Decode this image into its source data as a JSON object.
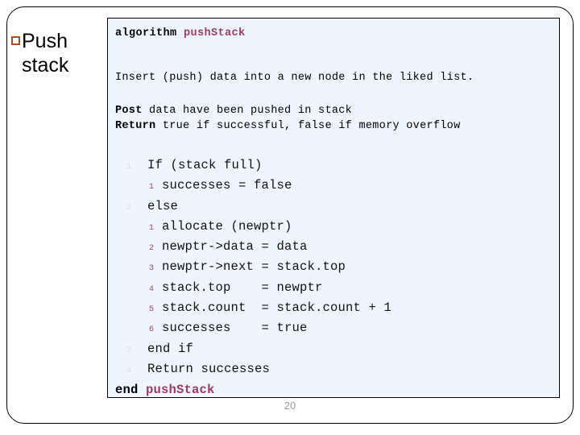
{
  "slide": {
    "title": "Push stack",
    "bullet_icon": "square-bullet-icon",
    "page_number": "20",
    "accent_bullet_color": "#a0522d",
    "panel_background": "#eff5fe",
    "algorithm_name_color": "#9e3b5e",
    "outer_number_color": "#d9dee8",
    "inner_number_color": "#a04a63"
  },
  "algorithm": {
    "header_keyword": "algorithm",
    "header_name": "pushStack",
    "intent": "Insert (push) data into a new node in the liked list.",
    "post_label": "Post",
    "post_text": "data have been pushed in stack",
    "return_label": "Return",
    "return_text": "true if successful, false if memory overflow",
    "end_keyword": "end",
    "end_name": "pushStack",
    "lines": [
      {
        "level": 1,
        "number": "1",
        "text": "If (stack full)"
      },
      {
        "level": 2,
        "number": "1",
        "text": "successes = false"
      },
      {
        "level": 1,
        "number": "2",
        "text": "else"
      },
      {
        "level": 2,
        "number": "1",
        "text": "allocate (newptr)"
      },
      {
        "level": 2,
        "number": "2",
        "text": "newptr->data = data"
      },
      {
        "level": 2,
        "number": "3",
        "text": "newptr->next = stack.top"
      },
      {
        "level": 2,
        "number": "4",
        "text": "stack.top    = newptr"
      },
      {
        "level": 2,
        "number": "5",
        "text": "stack.count  = stack.count + 1"
      },
      {
        "level": 2,
        "number": "6",
        "text": "successes    = true"
      },
      {
        "level": 1,
        "number": "3",
        "text": "end if"
      },
      {
        "level": 1,
        "number": "4",
        "text": "Return successes"
      }
    ]
  }
}
